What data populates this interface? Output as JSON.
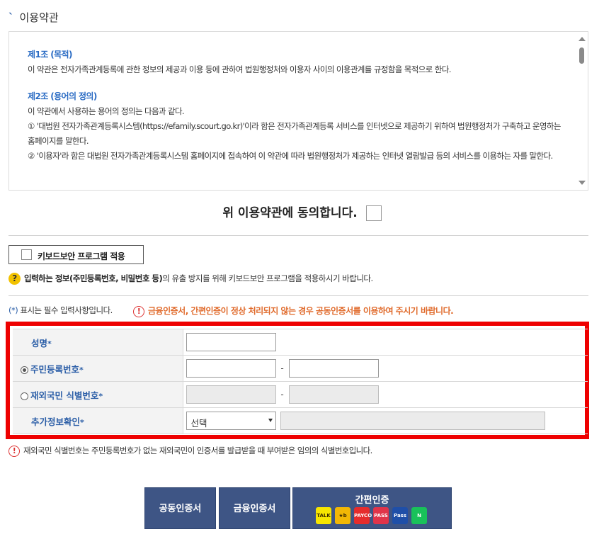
{
  "section": {
    "title": "이용약관"
  },
  "terms": {
    "art1_title": "제1조 (목적)",
    "art1_body": "이 약관은 전자가족관계등록에 관한 정보의 제공과 이용 등에 관하여 법원행정처와 이용자 사이의 이용관계를 규정함을 목적으로 한다.",
    "art2_title": "제2조 (용어의 정의)",
    "art2_intro": "이 약관에서 사용하는 용어의 정의는 다음과 같다.",
    "art2_item1": "① '대법원 전자가족관계등록시스템(https://efamily.scourt.go.kr)'이라 함은 전자가족관계등록 서비스를 인터넷으로 제공하기 위하여 법원행정처가 구축하고 운영하는 홈페이지를 말한다.",
    "art2_item2": "② '이용자'라 함은 대법원 전자가족관계등록시스템 홈페이지에 접속하여 이 약관에 따라 법원행정처가 제공하는 인터넷 열람발급 등의 서비스를 이용하는 자를 말한다."
  },
  "agree": {
    "label": "위 이용약관에 동의합니다."
  },
  "keyboard": {
    "button_label": "키보드보안 프로그램 적용",
    "help_bold": "입력하는 정보(주민등록번호, 비밀번호 등)",
    "help_rest": "의 유출 방지를 위해 키보드보안 프로그램을 적용하시기 바랍니다."
  },
  "notice": {
    "required_star": "(*)",
    "required_text": " 표시는 필수 입력사항입니다.",
    "warning": "금융인증서, 간편인증이 정상 처리되지 않는 경우 공동인증서를 이용하여 주시기 바랍니다."
  },
  "form": {
    "name_label": "성명",
    "resident_label": "주민등록번호",
    "foreign_label": "재외국민 식별번호",
    "extra_label": "추가정보확인",
    "star": "*",
    "dash": "-",
    "select_value": "선택"
  },
  "note": {
    "text": "재외국민 식별번호는 주민등록번호가 없는 재외국민이 인증서를 발급받을 때 부여받은 임의의 식별번호입니다."
  },
  "buttons": {
    "public_cert": "공동인증서",
    "finance_cert": "금융인증서",
    "easy_auth": "간편인증",
    "easy_icons": [
      {
        "name": "kakao-talk-icon",
        "label": "TALK",
        "color": "#f7e600"
      },
      {
        "name": "kb-icon",
        "label": "★b",
        "color": "#f2b705"
      },
      {
        "name": "payco-icon",
        "label": "PAYCO",
        "color": "#e62c2c"
      },
      {
        "name": "pass-icon",
        "label": "PASS",
        "color": "#e0344a"
      },
      {
        "name": "samsung-pass-icon",
        "label": "Pass",
        "color": "#1f4fa8"
      },
      {
        "name": "naver-icon",
        "label": "N",
        "color": "#19c15a"
      }
    ]
  },
  "colors": {
    "accent": "#2b5ea7",
    "warning": "#e06a2b",
    "highlight": "#ee0000",
    "button": "#3e5585"
  }
}
